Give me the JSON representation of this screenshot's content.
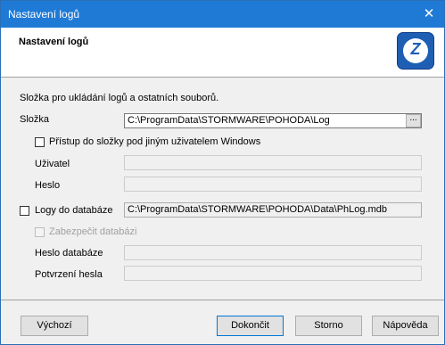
{
  "window": {
    "title": "Nastavení logů"
  },
  "header": {
    "title": "Nastavení logů",
    "logo_icon": "pohoda-logo-icon"
  },
  "intro": "Složka pro ukládání logů a ostatních souborů.",
  "folder": {
    "label": "Složka",
    "value": "C:\\ProgramData\\STORMWARE\\POHODA\\Log",
    "browse_label": "..."
  },
  "access_other_user": {
    "label": "Přístup do složky pod jiným uživatelem Windows",
    "checked": false
  },
  "user": {
    "label": "Uživatel",
    "value": ""
  },
  "password": {
    "label": "Heslo",
    "value": ""
  },
  "db_logs": {
    "label": "Logy do databáze",
    "checked": false,
    "value": "C:\\ProgramData\\STORMWARE\\POHODA\\Data\\PhLog.mdb"
  },
  "secure_db": {
    "label": "Zabezpečit databázi",
    "checked": false
  },
  "db_password": {
    "label": "Heslo databáze",
    "value": ""
  },
  "confirm_password": {
    "label": "Potvrzení hesla",
    "value": ""
  },
  "buttons": {
    "default": "Výchozí",
    "finish": "Dokončit",
    "cancel": "Storno",
    "help": "Nápověda"
  },
  "colors": {
    "titlebar": "#1f7ad6",
    "logo": "#1e5fb4"
  }
}
